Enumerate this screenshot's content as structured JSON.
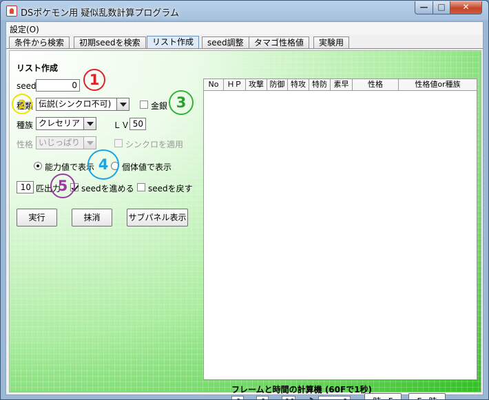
{
  "window": {
    "title": "DSポケモン用 疑似乱数計算プログラム",
    "controls": {
      "minimize": "—",
      "maximize": "□",
      "close": "✕"
    }
  },
  "menu": {
    "settings": "設定(O)"
  },
  "tabs": [
    {
      "label": "条件から検索",
      "active": false
    },
    {
      "label": "初期seedを検索",
      "active": false
    },
    {
      "label": "リスト作成",
      "active": true
    },
    {
      "label": "seed調整",
      "active": false
    },
    {
      "label": "タマゴ性格値",
      "active": false
    },
    {
      "label": "実験用",
      "active": false
    }
  ],
  "form": {
    "section_title": "リスト作成",
    "seed_label": "seed",
    "seed_value": "0",
    "kind_label": "種類",
    "kind_value": "伝説(シンクロ不可)",
    "gold_silver_label": "金銀",
    "species_label": "種族",
    "species_value": "クレセリア",
    "level_label": "ＬＶ",
    "level_value": "50",
    "nature_label": "性格",
    "nature_value": "いじっぱり",
    "synchro_label": "シンクロを適用",
    "radio_stats_label": "能力値で表示",
    "radio_iv_label": "個体値で表示",
    "count_value": "10",
    "count_label": "匹出力",
    "advance_seed_label": "seedを進める",
    "revert_seed_label": "seedを戻す",
    "execute_button": "実行",
    "erase_button": "抹消",
    "subpanel_button": "サブパネル表示"
  },
  "markers": [
    "1",
    "2",
    "3",
    "4",
    "5"
  ],
  "table": {
    "columns": [
      "No",
      "ＨＰ",
      "攻撃",
      "防御",
      "特攻",
      "特防",
      "素早",
      "性格",
      "性格値or種族"
    ]
  },
  "calculator": {
    "title": "フレームと時間の計算機 (60Fで1秒)",
    "minutes_value": "0",
    "minutes_label": "分",
    "seconds_value": "0",
    "seconds_label": "秒",
    "centis_value": "00",
    "frames_value": "0",
    "frames_label": "F",
    "time_to_frame_button": "時→F",
    "frame_to_time_button": "F→時"
  },
  "colors": {
    "marker1": "#e0202a",
    "marker2": "#f2e200",
    "marker3": "#33b233",
    "marker4": "#1aa6e6",
    "marker5": "#9b3aa0"
  }
}
